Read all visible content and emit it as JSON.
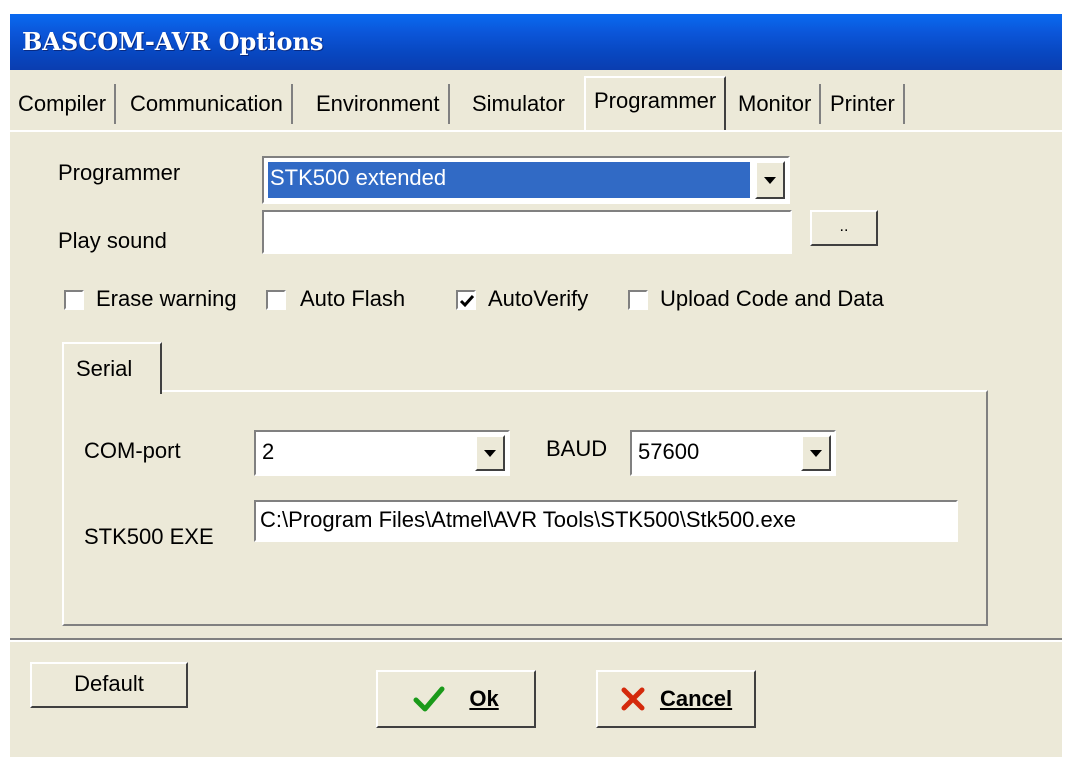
{
  "window": {
    "title": "BASCOM-AVR Options"
  },
  "tabs": [
    {
      "label": "Compiler"
    },
    {
      "label": "Communication"
    },
    {
      "label": "Environment"
    },
    {
      "label": "Simulator"
    },
    {
      "label": "Programmer",
      "active": true
    },
    {
      "label": "Monitor"
    },
    {
      "label": "Printer"
    }
  ],
  "programmer": {
    "label": "Programmer",
    "selected": "STK500 extended"
  },
  "play_sound": {
    "label": "Play sound",
    "value": "",
    "browse_label": ".."
  },
  "options": [
    {
      "label": "Erase warning",
      "checked": false
    },
    {
      "label": "Auto Flash",
      "checked": false
    },
    {
      "label": "AutoVerify",
      "checked": true
    },
    {
      "label": "Upload Code and Data",
      "checked": false
    }
  ],
  "serial": {
    "tab_label": "Serial",
    "com_port_label": "COM-port",
    "com_port_value": "2",
    "baud_label": "BAUD",
    "baud_value": "57600",
    "exe_label": "STK500 EXE",
    "exe_value": "C:\\Program Files\\Atmel\\AVR Tools\\STK500\\Stk500.exe"
  },
  "buttons": {
    "default": "Default",
    "ok": "Ok",
    "cancel": "Cancel"
  },
  "icons": {
    "ok": "checkmark-icon",
    "cancel": "x-cross-icon",
    "ok_color": "#1a9a1a",
    "cancel_color": "#d42a0c"
  }
}
